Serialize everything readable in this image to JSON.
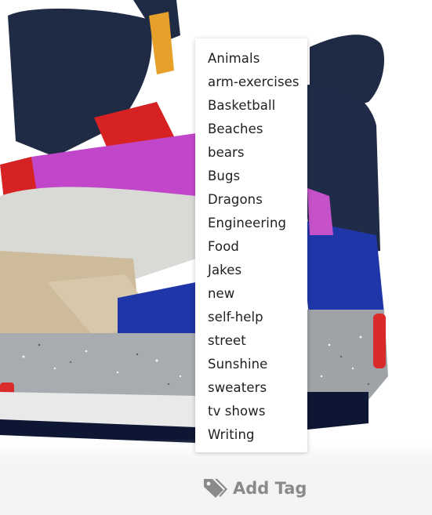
{
  "tag_menu": {
    "items": [
      "Animals",
      "arm-exercises",
      "Basketball",
      "Beaches",
      "bears",
      "Bugs",
      "Dragons",
      "Engineering",
      "Food",
      "Jakes",
      "new",
      "self-help",
      "street",
      "Sunshine",
      "sweaters",
      "tv shows",
      "Writing"
    ]
  },
  "add_tag": {
    "label": "Add Tag",
    "icon": "tags-icon",
    "color": "#8a8a8a"
  },
  "photo": {
    "subject": "product-image"
  }
}
